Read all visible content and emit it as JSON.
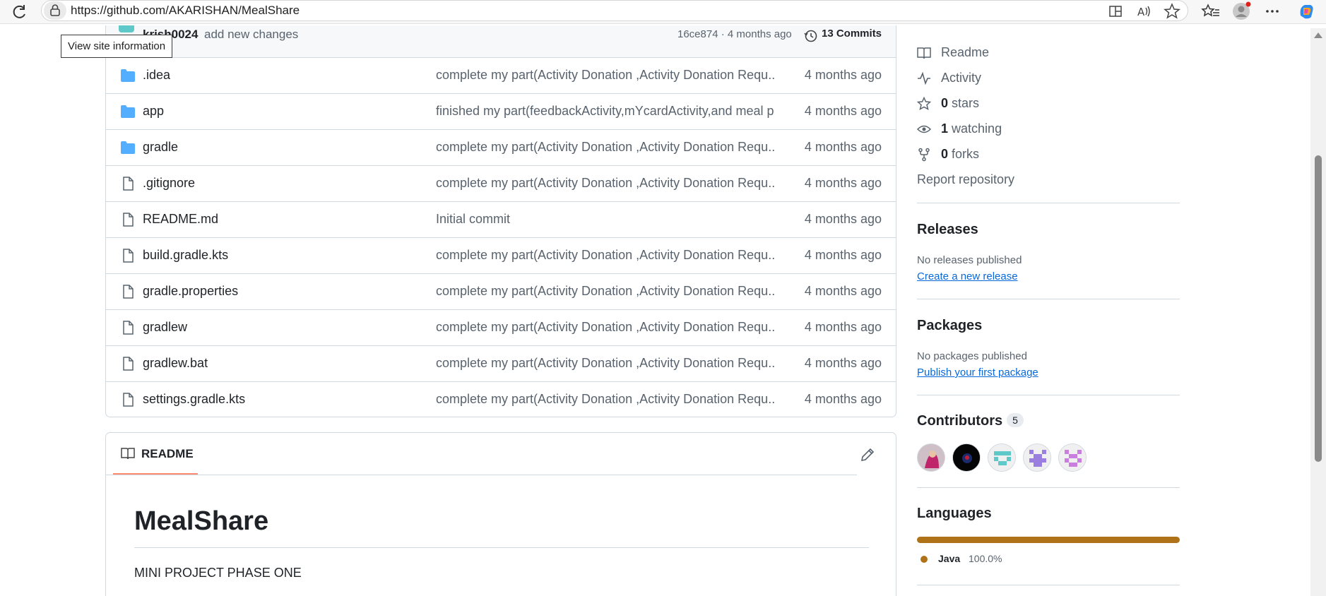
{
  "browser": {
    "url": "https://github.com/AKARISHAN/MealShare",
    "tooltip": "View site information"
  },
  "commit_header": {
    "user": "krish0024",
    "message": "add new changes",
    "hash_time": "16ce874 · 4 months ago",
    "commits_label": "13 Commits"
  },
  "files": [
    {
      "type": "folder",
      "name": ".idea",
      "commit": "complete my part(Activity Donation ,Activity Donation Requ...",
      "date": "4 months ago"
    },
    {
      "type": "folder",
      "name": "app",
      "commit": "finished my part(feedbackActivity,mYcardActivity,and meal p...",
      "date": "4 months ago"
    },
    {
      "type": "folder",
      "name": "gradle",
      "commit": "complete my part(Activity Donation ,Activity Donation Requ...",
      "date": "4 months ago"
    },
    {
      "type": "file",
      "name": ".gitignore",
      "commit": "complete my part(Activity Donation ,Activity Donation Requ...",
      "date": "4 months ago"
    },
    {
      "type": "file",
      "name": "README.md",
      "commit": "Initial commit",
      "date": "4 months ago"
    },
    {
      "type": "file",
      "name": "build.gradle.kts",
      "commit": "complete my part(Activity Donation ,Activity Donation Requ...",
      "date": "4 months ago"
    },
    {
      "type": "file",
      "name": "gradle.properties",
      "commit": "complete my part(Activity Donation ,Activity Donation Requ...",
      "date": "4 months ago"
    },
    {
      "type": "file",
      "name": "gradlew",
      "commit": "complete my part(Activity Donation ,Activity Donation Requ...",
      "date": "4 months ago"
    },
    {
      "type": "file",
      "name": "gradlew.bat",
      "commit": "complete my part(Activity Donation ,Activity Donation Requ...",
      "date": "4 months ago"
    },
    {
      "type": "file",
      "name": "settings.gradle.kts",
      "commit": "complete my part(Activity Donation ,Activity Donation Requ...",
      "date": "4 months ago"
    }
  ],
  "readme": {
    "tab_label": "README",
    "title": "MealShare",
    "text": "MINI PROJECT PHASE ONE"
  },
  "sidebar": {
    "readme_label": "Readme",
    "activity_label": "Activity",
    "stars_count": "0",
    "stars_label": "stars",
    "watching_count": "1",
    "watching_label": "watching",
    "forks_count": "0",
    "forks_label": "forks",
    "report_label": "Report repository",
    "releases_heading": "Releases",
    "releases_none": "No releases published",
    "releases_link": "Create a new release",
    "packages_heading": "Packages",
    "packages_none": "No packages published",
    "packages_link": "Publish your first package",
    "contributors_heading": "Contributors",
    "contributors_count": "5",
    "languages_heading": "Languages",
    "language_name": "Java",
    "language_pct": "100.0%",
    "language_color": "#b07219",
    "language_share": 1.0
  }
}
